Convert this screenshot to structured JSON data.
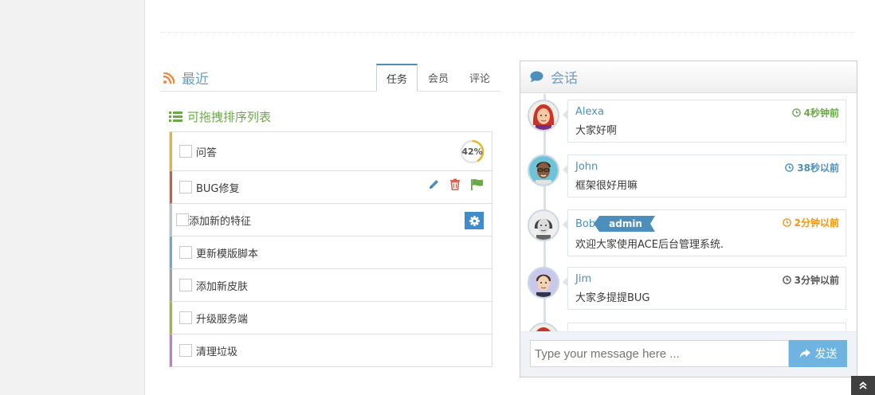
{
  "recent": {
    "title": "最近",
    "tabs": [
      {
        "label": "任务",
        "active": true
      },
      {
        "label": "会员",
        "active": false
      },
      {
        "label": "评论",
        "active": false
      }
    ],
    "sortable_title": "可拖拽排序列表",
    "tasks": [
      {
        "label": "问答",
        "color": "#e6b52a",
        "progress_percent": 42,
        "progress_label": "42%"
      },
      {
        "label": "BUG修复",
        "color": "#d15b47"
      },
      {
        "label": "添加新的特征",
        "color": "#b6c4d0"
      },
      {
        "label": "更新模版脚本",
        "color": "#6fa7d6"
      },
      {
        "label": "添加新皮肤",
        "color": "#a0a0a0"
      },
      {
        "label": "升级服务端",
        "color": "#9abc32"
      },
      {
        "label": "清理垃圾",
        "color": "#c67bd3"
      }
    ]
  },
  "conversation": {
    "title": "会话",
    "items": [
      {
        "name": "Alexa",
        "message": "大家好啊",
        "time": "4秒钟前",
        "time_color": "#69aa46",
        "badge": ""
      },
      {
        "name": "John",
        "message": "框架很好用嘛",
        "time": "38秒以前",
        "time_color": "#4c8fbd",
        "badge": ""
      },
      {
        "name": "Bob",
        "message": "欢迎大家使用ACE后台管理系统.",
        "time": "2分钟以前",
        "time_color": "#f89406",
        "badge": "admin"
      },
      {
        "name": "Jim",
        "message": "大家多提提BUG",
        "time": "3分钟以前",
        "time_color": "#555555",
        "badge": ""
      }
    ],
    "input_placeholder": "Type your message here ...",
    "send_label": "发送"
  },
  "colors": {
    "accent": "#4c8fbd",
    "green": "#69aa46",
    "send": "#6fb3e0"
  }
}
